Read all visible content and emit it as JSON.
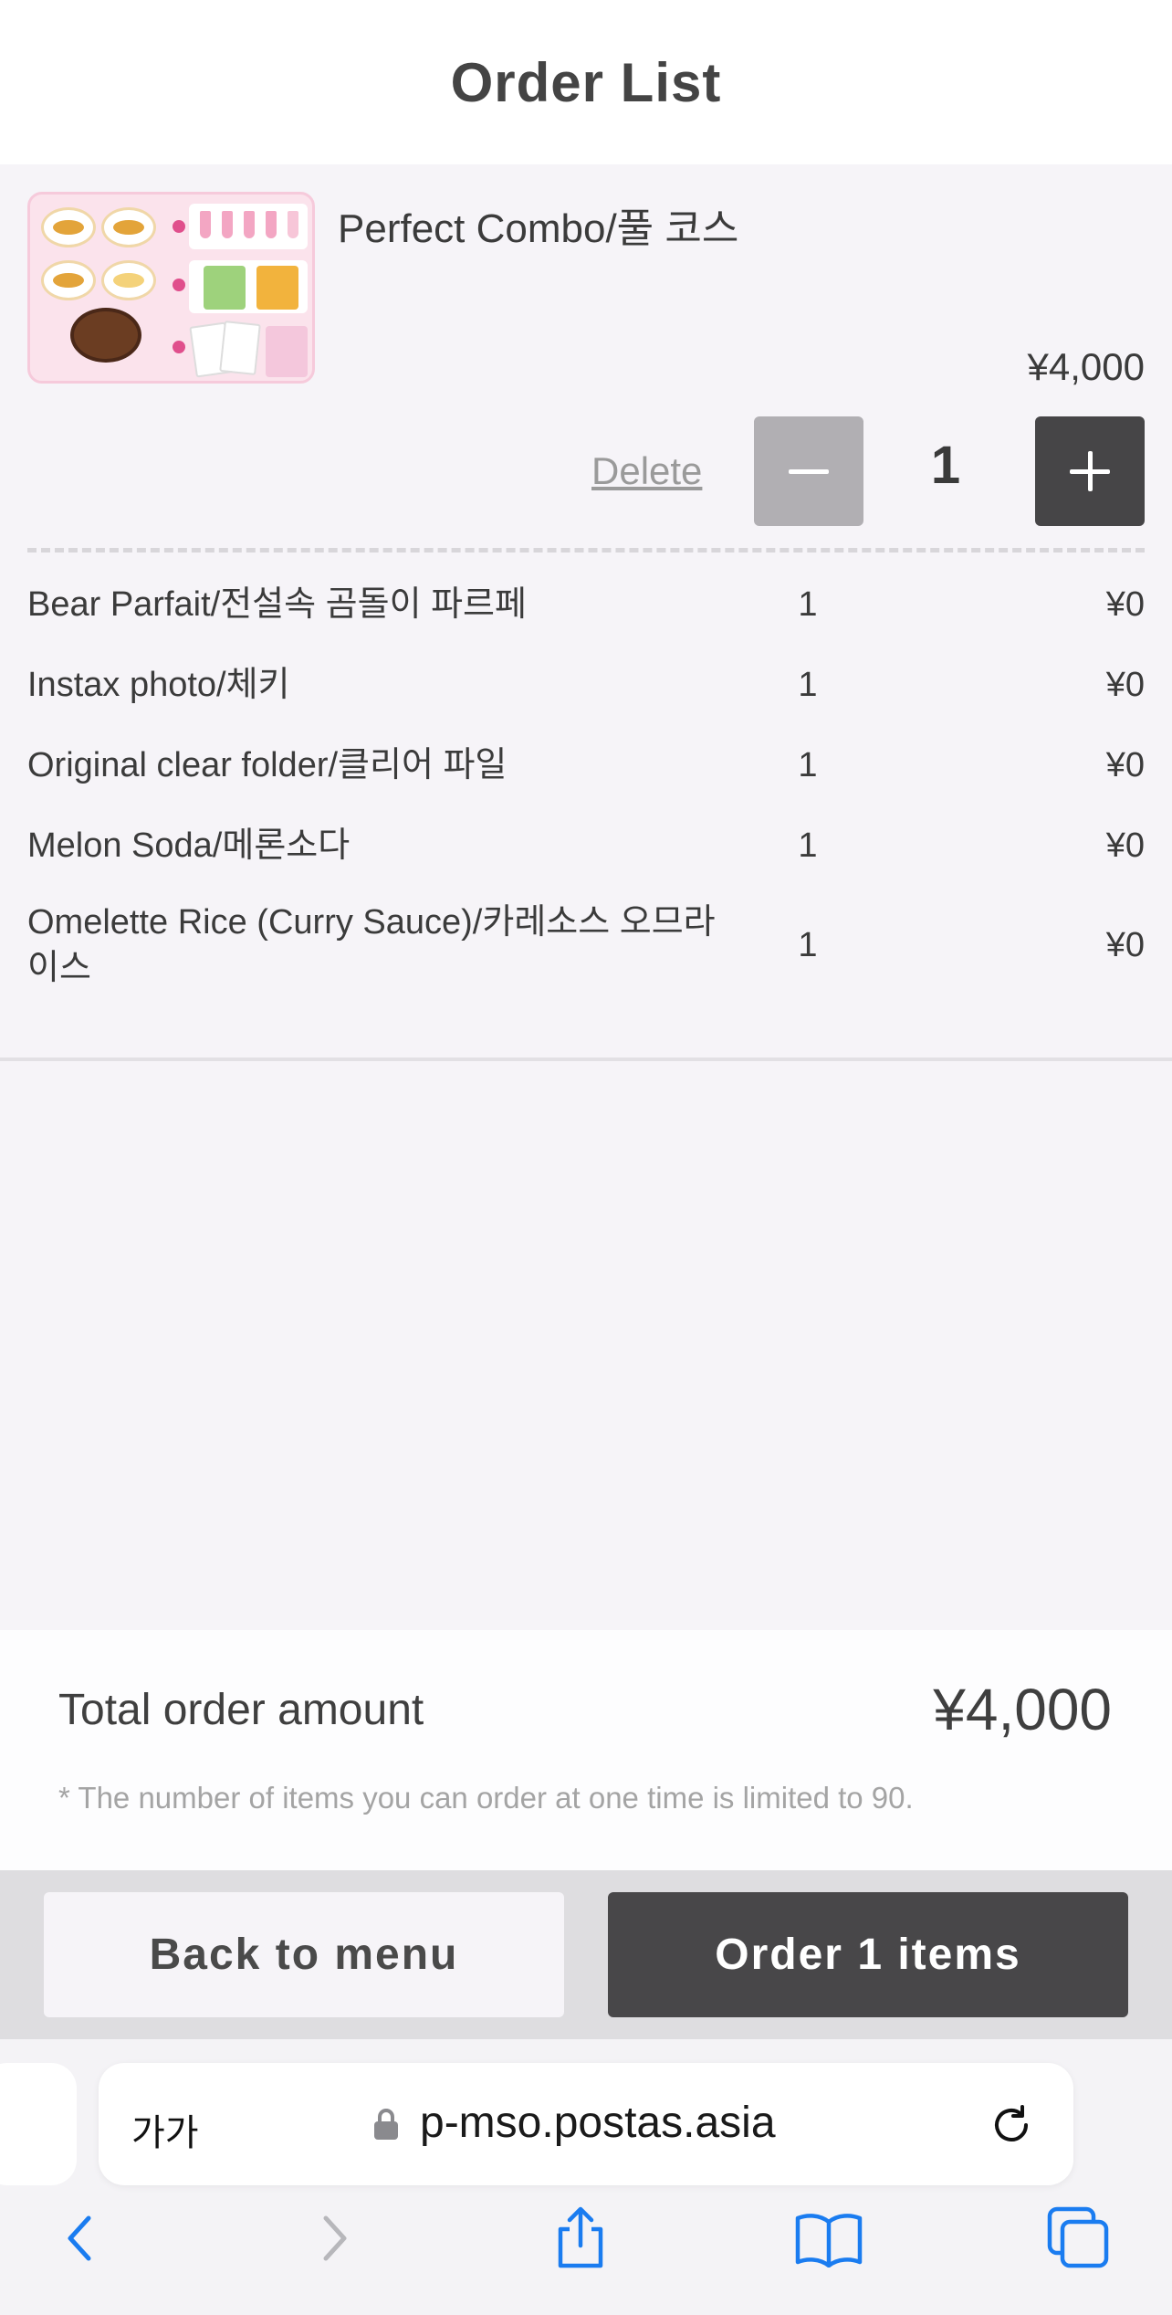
{
  "header": {
    "title": "Order List"
  },
  "order_item": {
    "name": "Perfect Combo/풀 코스",
    "price": "¥4,000",
    "delete_label": "Delete",
    "quantity": "1",
    "sub_items": [
      {
        "name": "Bear Parfait/전설속 곰돌이 파르페",
        "qty": "1",
        "price": "¥0"
      },
      {
        "name": "Instax photo/체키",
        "qty": "1",
        "price": "¥0"
      },
      {
        "name": "Original clear folder/클리어 파일",
        "qty": "1",
        "price": "¥0"
      },
      {
        "name": "Melon Soda/메론소다",
        "qty": "1",
        "price": "¥0"
      },
      {
        "name": "Omelette Rice (Curry Sauce)/카레소스 오므라이스",
        "qty": "1",
        "price": "¥0"
      }
    ]
  },
  "summary": {
    "total_label": "Total order amount",
    "total_value": "¥4,000",
    "note": "* The number of items you can order at one time is limited to 90."
  },
  "actions": {
    "back_label": "Back to menu",
    "order_label": "Order 1 items"
  },
  "browser": {
    "text_size_label": "가가",
    "url": "p-mso.postas.asia"
  },
  "colors": {
    "background": "#f6f4f8",
    "primary_button": "#484749",
    "ios_blue": "#1a7cf0"
  }
}
